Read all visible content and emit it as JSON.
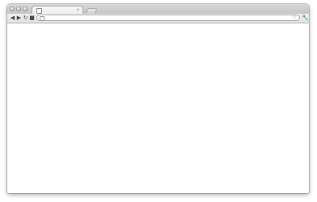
{
  "window": {
    "tab": {
      "favicon_icon": "page-icon",
      "close_icon": "close-icon",
      "close_glyph": "×"
    },
    "toolbar": {
      "back_glyph": "◀",
      "forward_glyph": "▶",
      "reload_glyph": "↻",
      "home_glyph": "■",
      "star_glyph": "☆",
      "wrench_glyph": "🔧"
    }
  },
  "colors": {
    "titlebar": "#cfcfcf",
    "toolbar": "#e9e9e9",
    "content": "#ffffff"
  }
}
